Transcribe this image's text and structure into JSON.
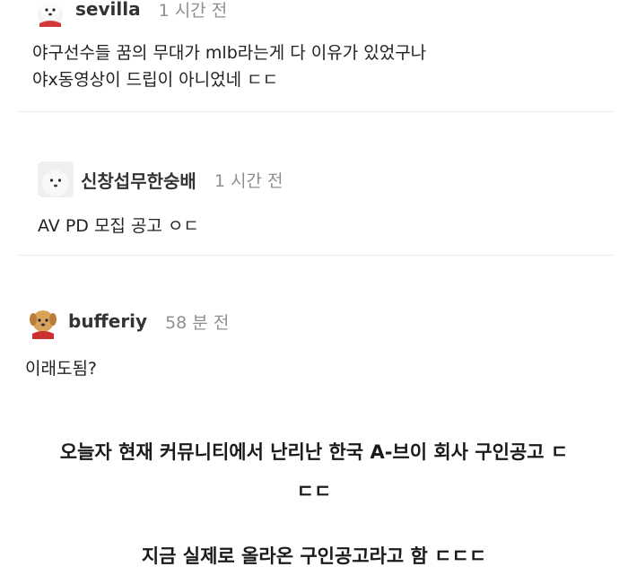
{
  "comments": [
    {
      "username": "sevilla",
      "time": "1 시간 전",
      "avatar_icon": "samoyed-dog-icon",
      "lines": [
        "야구선수들 꿈의 무대가 mlb라는게 다 이유가 있었구나",
        "야x동영상이 드립이 아니었네 ㄷㄷ"
      ]
    },
    {
      "username": "신창섭무한숭배",
      "time": "1 시간 전",
      "avatar_icon": "samoyed-dog-icon",
      "lines": [
        "AV PD 모집 공고 ㅇㄷ"
      ]
    },
    {
      "username": "bufferiy",
      "time": "58 분 전",
      "avatar_icon": "golden-puppy-icon",
      "lines": [
        "이래도됨?"
      ]
    }
  ],
  "caption": {
    "line1": "오늘자 현재 커뮤니티에서 난리난 한국 A-브이 회사 구인공고 ㄷ",
    "line2": "ㄷㄷ",
    "line3": "지금 실제로 올라온 구인공고라고 함 ㄷㄷㄷ"
  },
  "colors": {
    "text": "#222222",
    "username": "#333333",
    "time": "#8f8f8f",
    "divider": "#ececec"
  }
}
